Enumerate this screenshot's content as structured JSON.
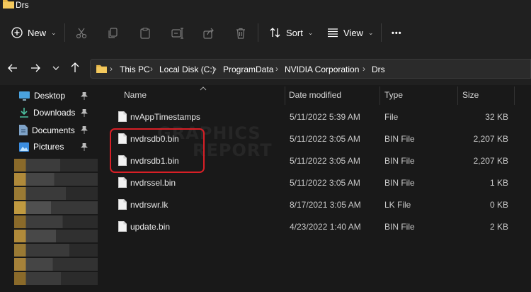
{
  "window": {
    "title": "Drs"
  },
  "toolbar": {
    "new_label": "New",
    "sort_label": "Sort",
    "view_label": "View",
    "more_label": "•••"
  },
  "address": {
    "crumbs": [
      "This PC",
      "Local Disk (C:)",
      "ProgramData",
      "NVIDIA Corporation",
      "Drs"
    ]
  },
  "nav": {
    "items": [
      {
        "label": "Desktop",
        "icon": "desktop-icon"
      },
      {
        "label": "Downloads",
        "icon": "download-icon"
      },
      {
        "label": "Documents",
        "icon": "documents-icon"
      },
      {
        "label": "Pictures",
        "icon": "pictures-icon"
      }
    ]
  },
  "columns": {
    "name": "Name",
    "date": "Date modified",
    "type": "Type",
    "size": "Size"
  },
  "files": [
    {
      "name": "nvAppTimestamps",
      "date": "5/11/2022 5:39 AM",
      "type": "File",
      "size": "32 KB"
    },
    {
      "name": "nvdrsdb0.bin",
      "date": "5/11/2022 3:05 AM",
      "type": "BIN File",
      "size": "2,207 KB"
    },
    {
      "name": "nvdrsdb1.bin",
      "date": "5/11/2022 3:05 AM",
      "type": "BIN File",
      "size": "2,207 KB"
    },
    {
      "name": "nvdrssel.bin",
      "date": "5/11/2022 3:05 AM",
      "type": "BIN File",
      "size": "1 KB"
    },
    {
      "name": "nvdrswr.lk",
      "date": "8/17/2021 3:05 AM",
      "type": "LK File",
      "size": "0 KB"
    },
    {
      "name": "update.bin",
      "date": "4/23/2022 1:40 AM",
      "type": "BIN File",
      "size": "2 KB"
    }
  ],
  "watermark": {
    "line1": "GRAPHICS",
    "line2": "REPORT"
  },
  "colors": {
    "highlight": "#d81f26",
    "folder": "#f0c040",
    "background": "#191919"
  }
}
